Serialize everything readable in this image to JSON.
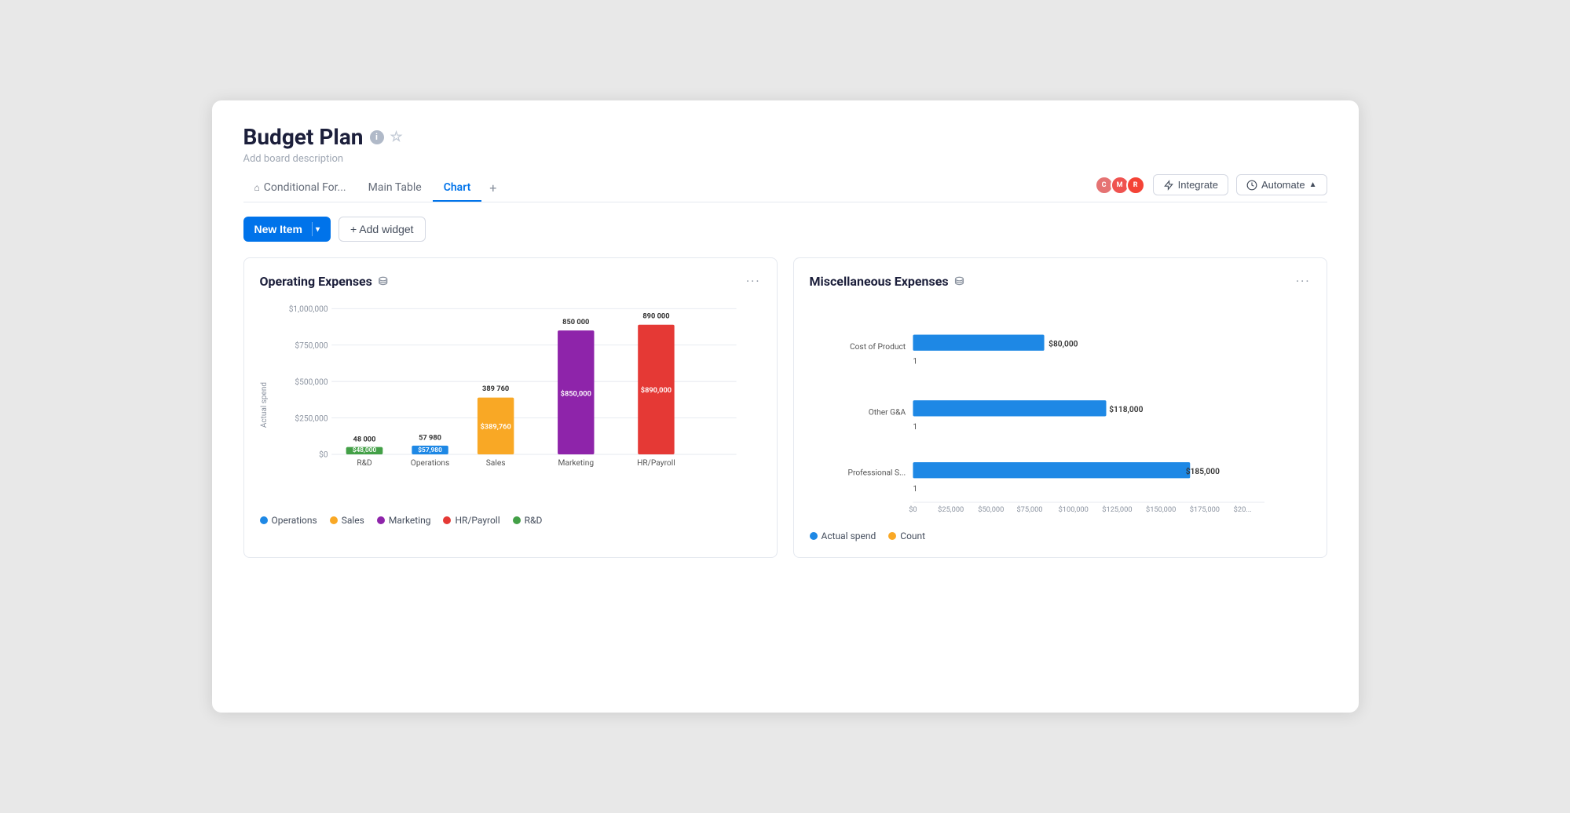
{
  "page": {
    "title": "Budget Plan",
    "description": "Add board description"
  },
  "tabs": [
    {
      "id": "conditional",
      "label": "Conditional For...",
      "icon": "⌂",
      "active": false
    },
    {
      "id": "main-table",
      "label": "Main Table",
      "active": false
    },
    {
      "id": "chart",
      "label": "Chart",
      "active": true
    }
  ],
  "toolbar": {
    "new_item_label": "New Item",
    "add_widget_label": "+ Add widget"
  },
  "header_actions": {
    "integrate_label": "Integrate",
    "automate_label": "Automate"
  },
  "charts": {
    "operating_expenses": {
      "title": "Operating Expenses",
      "y_axis_label": "Actual spend",
      "y_labels": [
        "$1,000,000",
        "$750,000",
        "$500,000",
        "$250,000",
        "$0"
      ],
      "bars": [
        {
          "category": "R&D",
          "value": 48000,
          "label": "48 000",
          "value_label": "$48,000",
          "color": "#43a047"
        },
        {
          "category": "Operations",
          "value": 57980,
          "label": "57 980",
          "value_label": "$57,980",
          "color": "#1e88e5"
        },
        {
          "category": "Sales",
          "value": 389760,
          "label": "389 760",
          "value_label": "$389,760",
          "color": "#f9a825"
        },
        {
          "category": "Marketing",
          "value": 850000,
          "label": "850 000",
          "value_label": "$850,000",
          "color": "#8e24aa"
        },
        {
          "category": "HR/Payroll",
          "value": 890000,
          "label": "890 000",
          "value_label": "$890,000",
          "color": "#e53935"
        }
      ],
      "legend": [
        {
          "label": "Operations",
          "color": "#1e88e5"
        },
        {
          "label": "Sales",
          "color": "#f9a825"
        },
        {
          "label": "Marketing",
          "color": "#8e24aa"
        },
        {
          "label": "HR/Payroll",
          "color": "#e53935"
        },
        {
          "label": "R&D",
          "color": "#43a047"
        }
      ]
    },
    "miscellaneous_expenses": {
      "title": "Miscellaneous Expenses",
      "x_labels": [
        "$0",
        "$25,000",
        "$50,000",
        "$75,000",
        "$100,000",
        "$125,000",
        "$150,000",
        "$175,000",
        "$20..."
      ],
      "bars": [
        {
          "category": "Cost of Product",
          "value": 80000,
          "label": "$80,000",
          "count": 1,
          "color": "#1e88e5"
        },
        {
          "category": "Other G&A",
          "value": 118000,
          "label": "$118,000",
          "count": 1,
          "color": "#1e88e5"
        },
        {
          "category": "Professional S...",
          "value": 185000,
          "label": "$185,000",
          "count": 1,
          "color": "#1e88e5"
        }
      ],
      "legend": [
        {
          "label": "Actual spend",
          "color": "#1e88e5"
        },
        {
          "label": "Count",
          "color": "#f9a825"
        }
      ]
    }
  }
}
